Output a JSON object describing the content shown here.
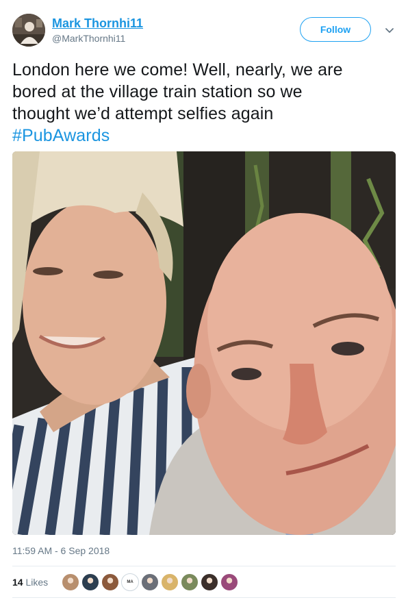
{
  "author": {
    "display_name": "Mark Thornhi11",
    "handle": "@MarkThornhi11",
    "follow_label": "Follow"
  },
  "tweet": {
    "lines": [
      "London here we come! Well, nearly,  we are",
      "bored at the village train station so we",
      "thought we’d attempt selfies again"
    ],
    "hashtag": "#PubAwards",
    "timestamp": "11:59 AM - 6 Sep 2018"
  },
  "engagement": {
    "likes_count": "14",
    "likes_label": "Likes",
    "likers": [
      {
        "icon": "liker-avatar-1",
        "color": "#b88f6e",
        "text": ""
      },
      {
        "icon": "liker-avatar-2",
        "color": "#2c3e50",
        "text": ""
      },
      {
        "icon": "liker-avatar-3",
        "color": "#8c5a3c",
        "text": ""
      },
      {
        "icon": "liker-avatar-4",
        "color": "#ffffff",
        "text": "MA"
      },
      {
        "icon": "liker-avatar-5",
        "color": "#6b6f78",
        "text": ""
      },
      {
        "icon": "liker-avatar-6",
        "color": "#d9b46a",
        "text": ""
      },
      {
        "icon": "liker-avatar-7",
        "color": "#7a8a5c",
        "text": ""
      },
      {
        "icon": "liker-avatar-8",
        "color": "#3b2f2a",
        "text": ""
      },
      {
        "icon": "liker-avatar-9",
        "color": "#9a4a7a",
        "text": ""
      }
    ]
  },
  "colors": {
    "link": "#1b95e0",
    "follow_border": "#1da1f2",
    "secondary_text": "#657786",
    "divider": "#e6ecf0"
  }
}
